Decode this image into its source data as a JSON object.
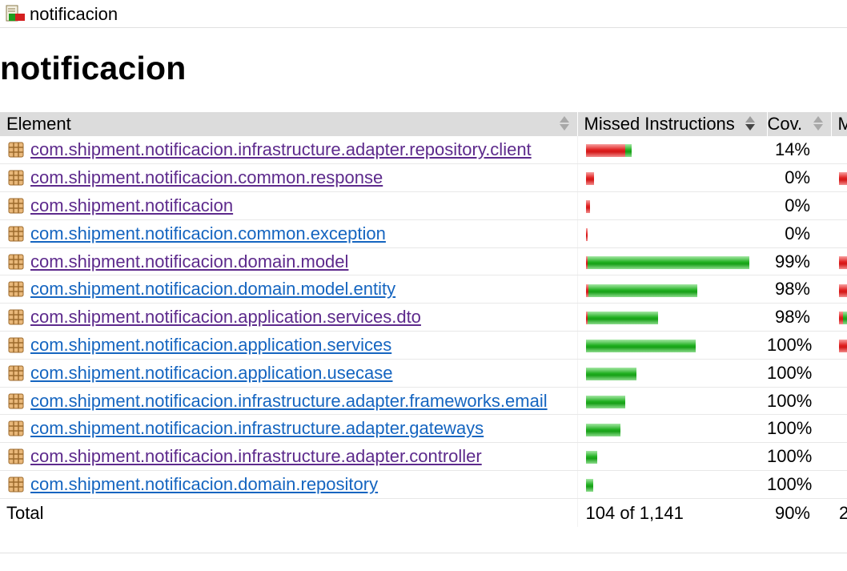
{
  "breadcrumb": {
    "label": "notificacion"
  },
  "page": {
    "title": "notificacion"
  },
  "table": {
    "headers": {
      "element": "Element",
      "missed_instructions": "Missed Instructions",
      "coverage": "Cov.",
      "next": "M"
    },
    "rows": [
      {
        "name": "com.shipment.notificacion.infrastructure.adapter.repository.client",
        "visited": true,
        "bar_fraction": 0.28,
        "missed_fraction": 0.86,
        "cov": "14%",
        "next_mark": "none"
      },
      {
        "name": "com.shipment.notificacion.common.response",
        "visited": true,
        "bar_fraction": 0.05,
        "missed_fraction": 1.0,
        "cov": "0%",
        "next_mark": "red"
      },
      {
        "name": "com.shipment.notificacion",
        "visited": true,
        "bar_fraction": 0.025,
        "missed_fraction": 1.0,
        "cov": "0%",
        "next_mark": "none"
      },
      {
        "name": "com.shipment.notificacion.common.exception",
        "visited": false,
        "bar_fraction": 0.01,
        "missed_fraction": 1.0,
        "cov": "0%",
        "next_mark": "none"
      },
      {
        "name": "com.shipment.notificacion.domain.model",
        "visited": true,
        "bar_fraction": 1.0,
        "missed_fraction": 0.01,
        "cov": "99%",
        "next_mark": "red"
      },
      {
        "name": "com.shipment.notificacion.domain.model.entity",
        "visited": false,
        "bar_fraction": 0.68,
        "missed_fraction": 0.02,
        "cov": "98%",
        "next_mark": "red"
      },
      {
        "name": "com.shipment.notificacion.application.services.dto",
        "visited": true,
        "bar_fraction": 0.44,
        "missed_fraction": 0.02,
        "cov": "98%",
        "next_mark": "redgreen"
      },
      {
        "name": "com.shipment.notificacion.application.services",
        "visited": false,
        "bar_fraction": 0.67,
        "missed_fraction": 0.0,
        "cov": "100%",
        "next_mark": "red"
      },
      {
        "name": "com.shipment.notificacion.application.usecase",
        "visited": false,
        "bar_fraction": 0.31,
        "missed_fraction": 0.0,
        "cov": "100%",
        "next_mark": "none"
      },
      {
        "name": "com.shipment.notificacion.infrastructure.adapter.frameworks.email",
        "visited": false,
        "bar_fraction": 0.24,
        "missed_fraction": 0.0,
        "cov": "100%",
        "next_mark": "none"
      },
      {
        "name": "com.shipment.notificacion.infrastructure.adapter.gateways",
        "visited": false,
        "bar_fraction": 0.21,
        "missed_fraction": 0.0,
        "cov": "100%",
        "next_mark": "none"
      },
      {
        "name": "com.shipment.notificacion.infrastructure.adapter.controller",
        "visited": true,
        "bar_fraction": 0.07,
        "missed_fraction": 0.0,
        "cov": "100%",
        "next_mark": "none"
      },
      {
        "name": "com.shipment.notificacion.domain.repository",
        "visited": false,
        "bar_fraction": 0.045,
        "missed_fraction": 0.0,
        "cov": "100%",
        "next_mark": "none"
      }
    ],
    "total": {
      "label": "Total",
      "missed": "104 of 1,141",
      "cov": "90%",
      "next": "2"
    }
  },
  "colors": {
    "visited_link": "#5d2a8c",
    "link": "#1565c0",
    "bar_red": "#d41818",
    "bar_green": "#17a017",
    "header_bg": "#dcdcdc"
  },
  "icons": {
    "breadcrumb": "report-icon",
    "package": "package-icon",
    "sort": "sort-icon"
  }
}
